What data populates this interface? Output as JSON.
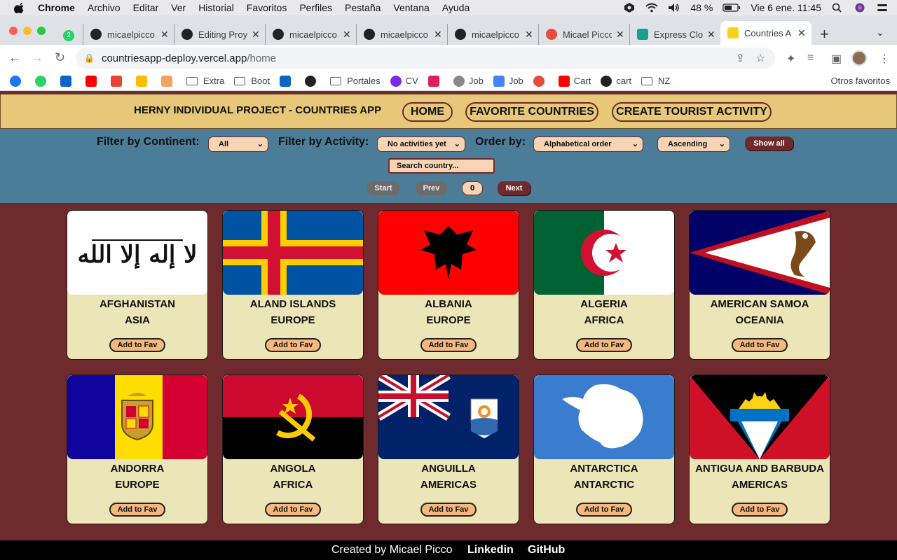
{
  "os_menubar": {
    "app": "Chrome",
    "items": [
      "Archivo",
      "Editar",
      "Ver",
      "Historial",
      "Favoritos",
      "Perfiles",
      "Pestaña",
      "Ventana",
      "Ayuda"
    ],
    "battery": "48 %",
    "clock": "Vie 6 ene.  11:45"
  },
  "browser": {
    "tabs": [
      {
        "title": "micaelpicco",
        "icon": "github-icon"
      },
      {
        "title": "Editing Proy",
        "icon": "github-icon"
      },
      {
        "title": "micaelpicco",
        "icon": "github-icon"
      },
      {
        "title": "micaelpicco",
        "icon": "github-icon"
      },
      {
        "title": "micaelpicco",
        "icon": "github-icon"
      },
      {
        "title": "Micael Picco",
        "icon": "portfolio-icon"
      },
      {
        "title": "Express Clo",
        "icon": "express-icon"
      },
      {
        "title": "Countries A",
        "icon": "countries-icon"
      }
    ],
    "url_host": "countriesapp-deploy.vercel.app",
    "url_path": "/home",
    "bookmarks": [
      {
        "label": "",
        "icon": "facebook-icon"
      },
      {
        "label": "",
        "icon": "whatsapp-icon"
      },
      {
        "label": "",
        "icon": "outlook-icon"
      },
      {
        "label": "",
        "icon": "youtube-icon"
      },
      {
        "label": "",
        "icon": "gmail-icon"
      },
      {
        "label": "",
        "icon": "drive-icon"
      },
      {
        "label": "",
        "icon": "cube-icon"
      },
      {
        "label": "Extra",
        "icon": "folder-icon"
      },
      {
        "label": "Boot",
        "icon": "folder-icon"
      },
      {
        "label": "",
        "icon": "linkedin-icon"
      },
      {
        "label": "",
        "icon": "github-icon"
      },
      {
        "label": "Portales",
        "icon": "folder-icon"
      },
      {
        "label": "CV",
        "icon": "canva-icon"
      },
      {
        "label": "",
        "icon": "slack-icon"
      },
      {
        "label": "Job",
        "icon": "search-icon"
      },
      {
        "label": "Job",
        "icon": "docs-icon"
      },
      {
        "label": "",
        "icon": "target-icon"
      },
      {
        "label": "Cart",
        "icon": "youtube-icon"
      },
      {
        "label": "cart",
        "icon": "github-icon"
      },
      {
        "label": "NZ",
        "icon": "folder-icon"
      }
    ],
    "other_bookmarks": "Otros favoritos"
  },
  "app": {
    "title": "HERNY INDIVIDUAL PROJECT - COUNTRIES APP",
    "nav": [
      "HOME",
      "FAVORITE COUNTRIES",
      "CREATE TOURIST ACTIVITY"
    ],
    "filters": {
      "continent_label": "Filter by Continent:",
      "continent_value": "All",
      "activity_label": "Filter by Activity:",
      "activity_value": "No activities yet",
      "order_label": "Order by:",
      "order_value": "Alphabetical order",
      "direction_value": "Ascending",
      "show_all": "Show all",
      "search_placeholder": "Search country..."
    },
    "pagination": {
      "start": "Start",
      "prev": "Prev",
      "page": "0",
      "next": "Next"
    },
    "add_fav_label": "Add to Fav",
    "countries": [
      {
        "name": "AFGHANISTAN",
        "continent": "ASIA",
        "flag": "afghanistan-flag"
      },
      {
        "name": "ALAND ISLANDS",
        "continent": "EUROPE",
        "flag": "aland-flag"
      },
      {
        "name": "ALBANIA",
        "continent": "EUROPE",
        "flag": "albania-flag"
      },
      {
        "name": "ALGERIA",
        "continent": "AFRICA",
        "flag": "algeria-flag"
      },
      {
        "name": "AMERICAN SAMOA",
        "continent": "OCEANIA",
        "flag": "american-samoa-flag"
      },
      {
        "name": "ANDORRA",
        "continent": "EUROPE",
        "flag": "andorra-flag"
      },
      {
        "name": "ANGOLA",
        "continent": "AFRICA",
        "flag": "angola-flag"
      },
      {
        "name": "ANGUILLA",
        "continent": "AMERICAS",
        "flag": "anguilla-flag"
      },
      {
        "name": "ANTARCTICA",
        "continent": "ANTARCTIC",
        "flag": "antarctica-flag"
      },
      {
        "name": "ANTIGUA AND BARBUDA",
        "continent": "AMERICAS",
        "flag": "antigua-flag"
      }
    ],
    "footer": {
      "credit": "Created by Micael Picco",
      "linkedin": "Linkedin",
      "github": "GitHub"
    }
  }
}
